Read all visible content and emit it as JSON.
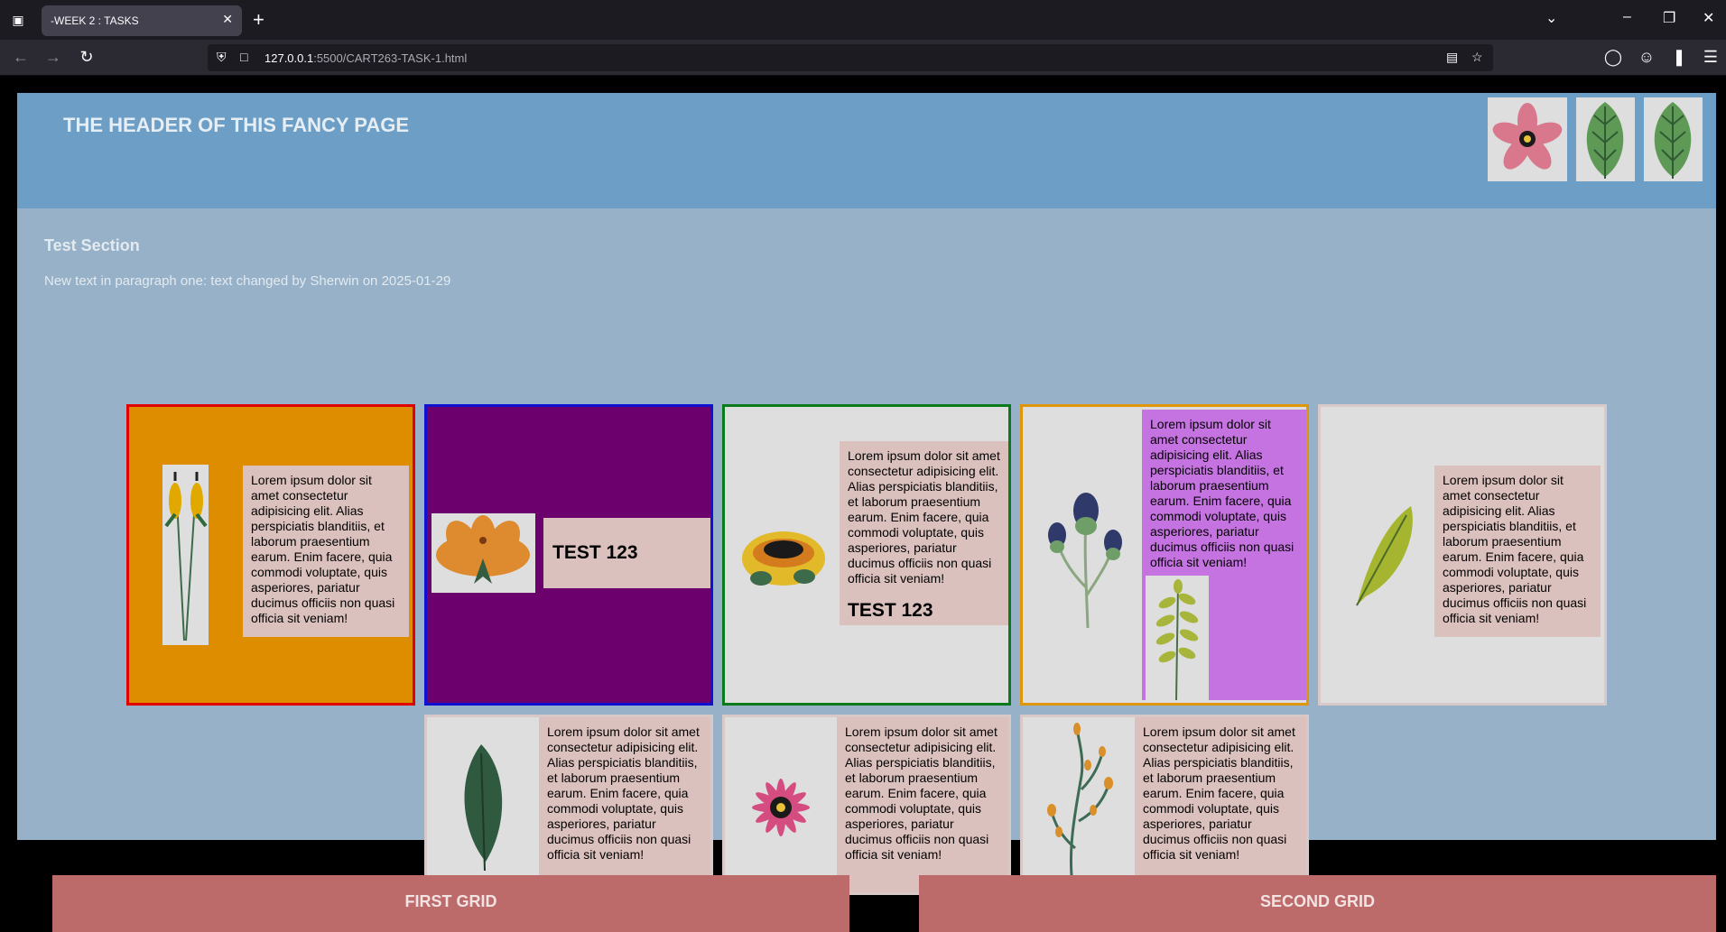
{
  "browser": {
    "tab_title": "-WEEK 2 : TASKS",
    "url_host": "127.0.0.1",
    "url_path": ":5500/CART263-TASK-1.html"
  },
  "page": {
    "header_title": "THE HEADER OF THIS FANCY PAGE",
    "section_title": "Test Section",
    "section_paragraph": "New text in paragraph one: text changed by Sherwin on 2025-01-29",
    "lorem": "Lorem ipsum dolor sit amet consectetur adipisicing elit. Alias perspiciatis blanditiis, et laborum praesentium earum. Enim facere, quia commodi voluptate, quis asperiores, pariatur ducimus officiis non quasi officia sit veniam!",
    "test_label": "TEST 123",
    "first_grid": "FIRST GRID",
    "second_grid": "SECOND GRID"
  },
  "colors": {
    "header_bg": "#6c9ec6",
    "section_bg": "#96b1c8",
    "card1_bg": "#de8d00",
    "card1_border": "#e00000",
    "card2_bg": "#6c006c",
    "card2_border": "#1010d0",
    "card3_border": "#0a7a1a",
    "card4_border": "#e0960a",
    "purple_box": "#c573e0",
    "text_box": "#dbc1bd",
    "grid_label_bg": "#bc6a6a"
  },
  "icons": [
    "tab-list-icon",
    "close-icon",
    "plus-icon",
    "back-icon",
    "forward-icon",
    "reload-icon",
    "shield-icon",
    "page-icon",
    "reader-icon",
    "bookmark-star-icon",
    "pocket-icon",
    "account-icon",
    "extensions-icon",
    "menu-icon"
  ]
}
